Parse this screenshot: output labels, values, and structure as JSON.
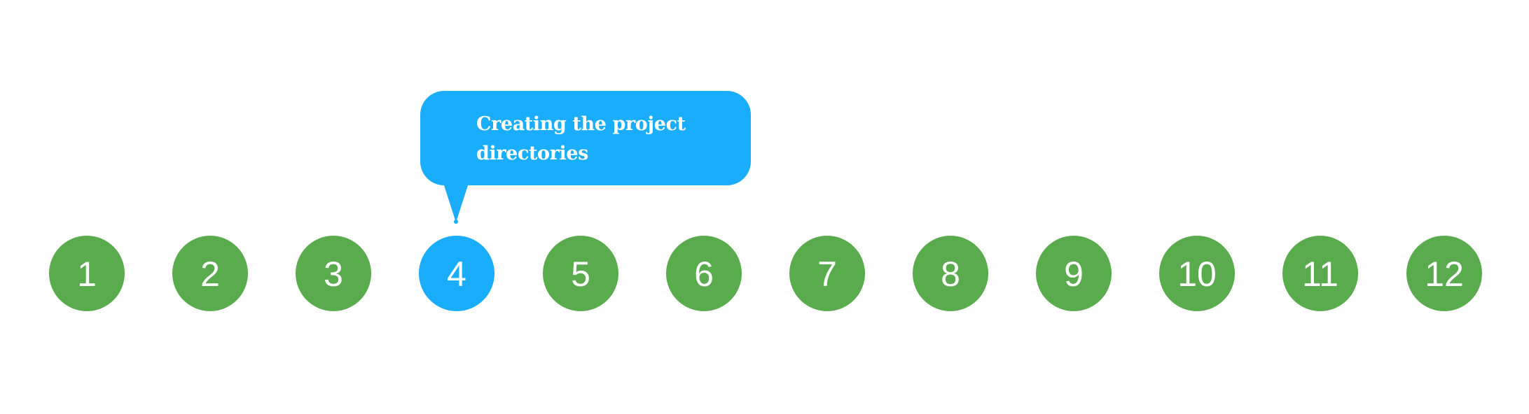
{
  "stepper": {
    "active_index": 3,
    "steps": [
      {
        "label": "1"
      },
      {
        "label": "2"
      },
      {
        "label": "3"
      },
      {
        "label": "4"
      },
      {
        "label": "5"
      },
      {
        "label": "6"
      },
      {
        "label": "7"
      },
      {
        "label": "8"
      },
      {
        "label": "9"
      },
      {
        "label": "10"
      },
      {
        "label": "11"
      },
      {
        "label": "12"
      }
    ],
    "colors": {
      "step": "#5aab4e",
      "active_step": "#1aadfc",
      "text": "#ffffff"
    }
  },
  "tooltip": {
    "text": "Creating the project directories",
    "color": "#1aadfc"
  }
}
